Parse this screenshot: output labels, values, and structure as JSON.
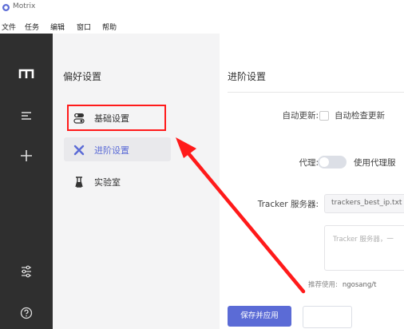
{
  "window": {
    "title": "Motrix"
  },
  "menubar": [
    "文件",
    "任务",
    "编辑",
    "窗口",
    "帮助"
  ],
  "rail": {
    "icons": [
      "motrix-logo-icon",
      "task-list-icon",
      "add-task-icon",
      "preferences-icon",
      "help-icon"
    ]
  },
  "sidebar": {
    "title": "偏好设置",
    "items": [
      {
        "label": "基础设置",
        "icon": "toggle-switch-icon",
        "active": false
      },
      {
        "label": "进阶设置",
        "icon": "wrench-tools-icon",
        "active": true
      },
      {
        "label": "实验室",
        "icon": "lab-flask-icon",
        "active": false
      }
    ]
  },
  "main": {
    "title": "进阶设置",
    "auto_update": {
      "label": "自动更新:",
      "checkbox_label": "自动检查更新",
      "checked": false
    },
    "proxy": {
      "label": "代理:",
      "toggle_label": "使用代理服",
      "enabled": false
    },
    "tracker": {
      "label": "Tracker 服务器:",
      "select_value": "trackers_best_ip.txt",
      "textarea_placeholder": "Tracker 服务器，一",
      "recommend_label": "推荐使用:",
      "recommend_link": "ngosang/t"
    },
    "save_button": "保存并应用"
  },
  "colors": {
    "accent": "#5b6bd6",
    "rail_bg": "#2f2f2f",
    "sidebar_bg": "#f4f4f5",
    "annotation": "#ff1a1a"
  },
  "annotation": {
    "target": "sidebar-item-basic",
    "color": "#ff1a1a"
  }
}
